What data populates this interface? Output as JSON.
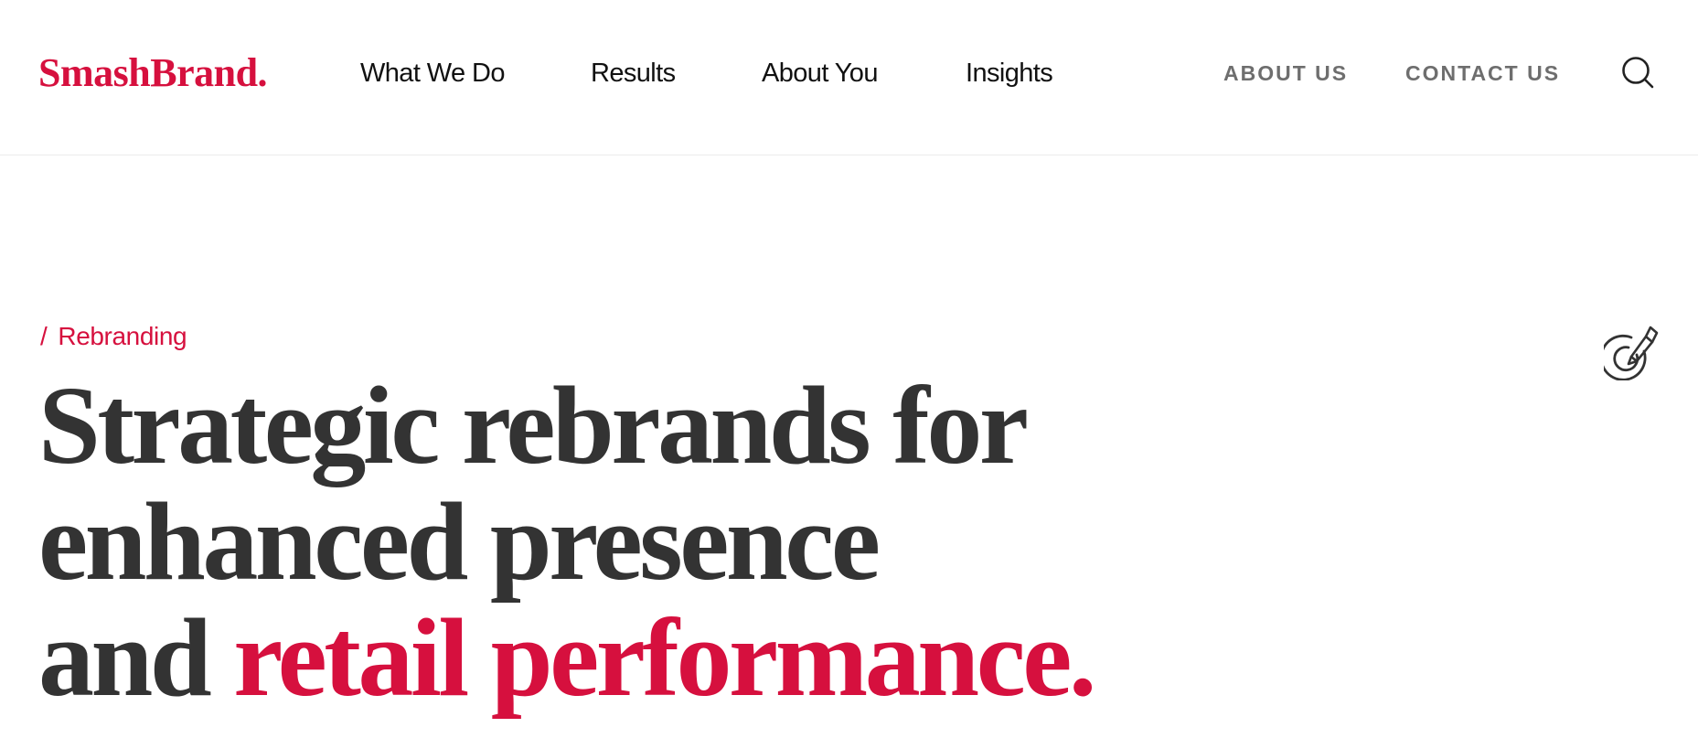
{
  "colors": {
    "brand": "#d6103e",
    "heading": "#333333",
    "nav_text": "#111111",
    "utility_text": "#6e6e6e",
    "divider": "#ebebeb",
    "background": "#ffffff"
  },
  "header": {
    "logo_text": "SmashBrand.",
    "nav": [
      {
        "label": "What We Do"
      },
      {
        "label": "Results"
      },
      {
        "label": "About You"
      },
      {
        "label": "Insights"
      }
    ],
    "utility": [
      {
        "label": "ABOUT US"
      },
      {
        "label": "CONTACT US"
      }
    ],
    "search_icon": "search-icon"
  },
  "hero": {
    "breadcrumb_separator": "/",
    "breadcrumb_label": "Rebranding",
    "section_icon": "target-pencil-icon",
    "title_line1": "Strategic rebrands for",
    "title_line2": "enhanced presence",
    "title_line3_prefix": "and ",
    "title_line3_accent": "retail performance."
  }
}
